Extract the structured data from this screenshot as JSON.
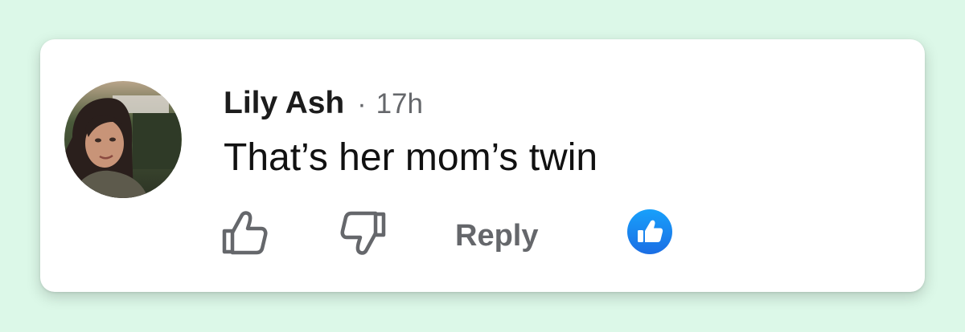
{
  "comment": {
    "author": "Lily Ash",
    "separator": "·",
    "time": "17h",
    "text": "That’s her mom’s twin"
  },
  "actions": {
    "like_icon": "thumbs-up-outline-icon",
    "dislike_icon": "thumbs-down-outline-icon",
    "reply_label": "Reply",
    "reaction_icon": "like-reaction-icon"
  },
  "colors": {
    "page_background": "#dcf8e8",
    "card_background": "#ffffff",
    "muted_text": "#65676b",
    "reaction_blue": "#1b74e4"
  }
}
